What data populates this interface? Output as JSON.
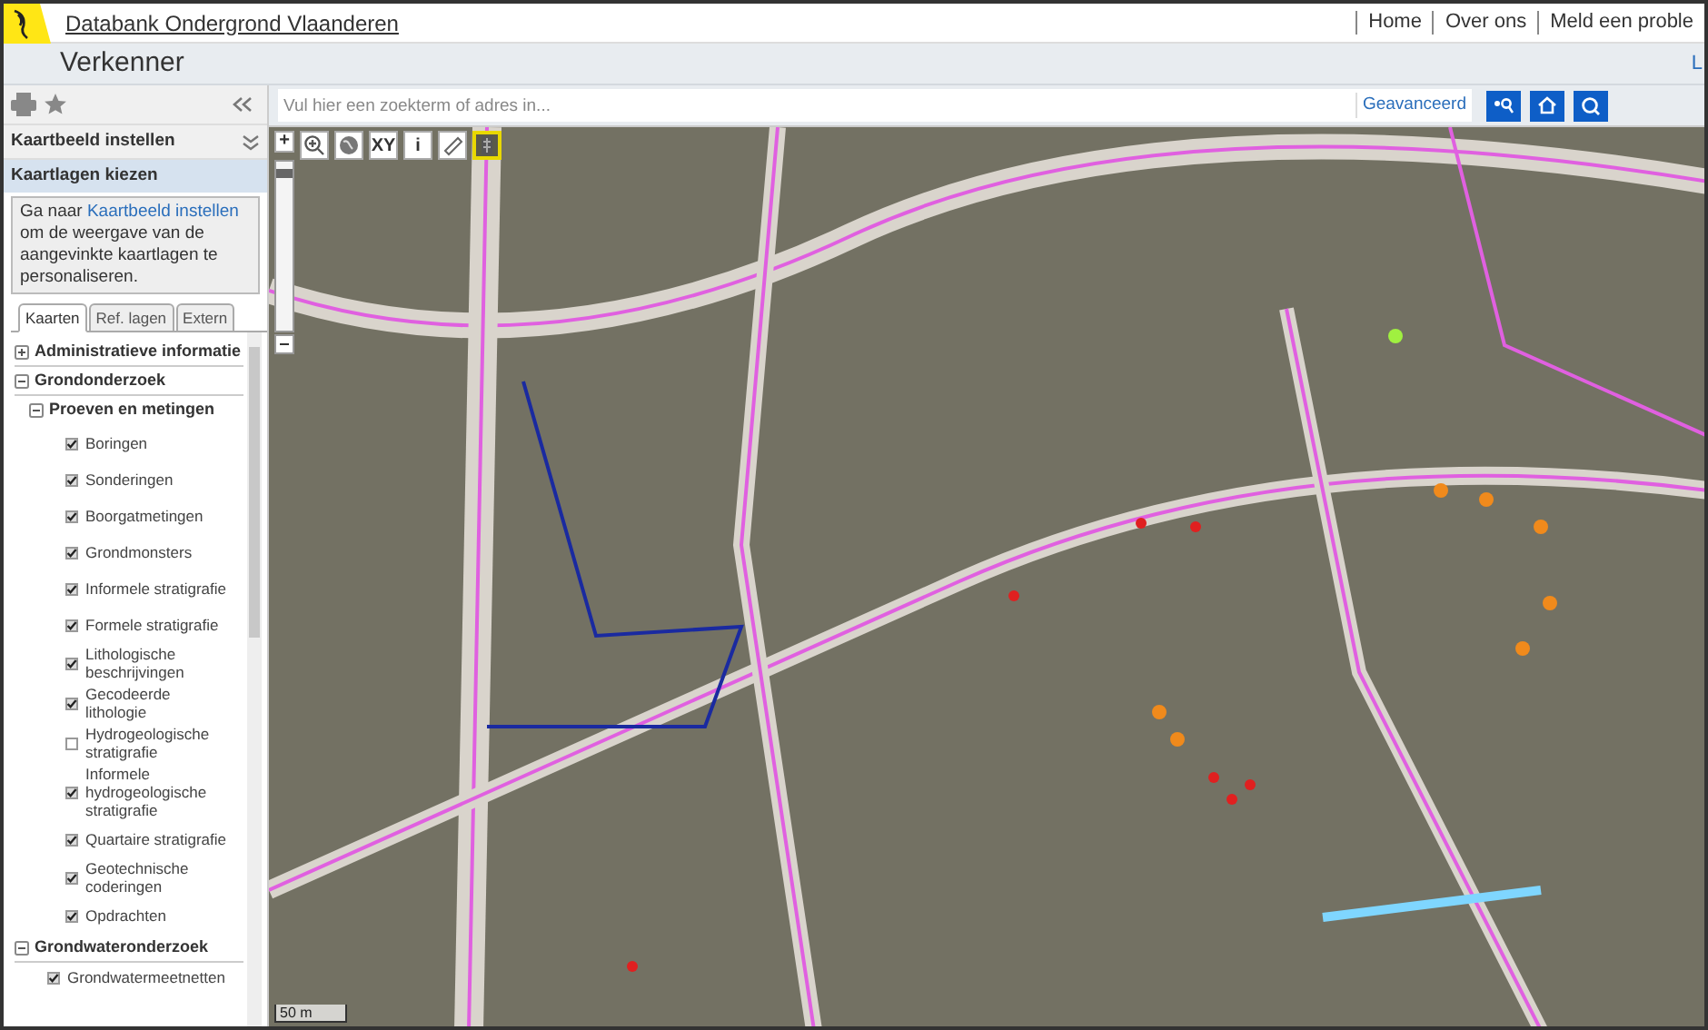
{
  "header": {
    "site_title": "Databank Ondergrond Vlaanderen",
    "links": [
      "Home",
      "Over ons",
      "Meld een proble"
    ]
  },
  "title_bar": {
    "title": "Verkenner",
    "right_text": "L"
  },
  "sidebar": {
    "sections": [
      {
        "label": "Kaartbeeld instellen",
        "selected": false
      },
      {
        "label": "Kaartlagen kiezen",
        "selected": true
      }
    ],
    "info_parts": [
      "Ga naar ",
      "Kaartbeeld instellen",
      " om de weergave van de aangevinkte kaartlagen te personaliseren."
    ],
    "tabs": [
      {
        "label": "Kaarten",
        "selected": true
      },
      {
        "label": "Ref. lagen",
        "selected": false
      },
      {
        "label": "Extern",
        "selected": false
      }
    ],
    "tree": [
      {
        "label": "Administratieve informatie",
        "kind": "group",
        "expanded": false
      },
      {
        "label": "Grondonderzoek",
        "kind": "group",
        "expanded": true,
        "children": [
          {
            "label": "Proeven en metingen",
            "kind": "group",
            "expanded": true,
            "children": [
              {
                "label": "Boringen",
                "kind": "layer",
                "checked": true
              },
              {
                "label": "Sonderingen",
                "kind": "layer",
                "checked": true
              },
              {
                "label": "Boorgatmetingen",
                "kind": "layer",
                "checked": true
              },
              {
                "label": "Grondmonsters",
                "kind": "layer",
                "checked": true
              },
              {
                "label": "Informele stratigrafie",
                "kind": "layer",
                "checked": true
              },
              {
                "label": "Formele stratigrafie",
                "kind": "layer",
                "checked": true
              },
              {
                "label": "Lithologische beschrijvingen",
                "kind": "layer",
                "checked": true
              },
              {
                "label": "Gecodeerde lithologie",
                "kind": "layer",
                "checked": true
              },
              {
                "label": "Hydrogeologische stratigrafie",
                "kind": "layer",
                "checked": false
              },
              {
                "label": "Informele hydrogeologische stratigrafie",
                "kind": "layer",
                "checked": true
              },
              {
                "label": "Quartaire stratigrafie",
                "kind": "layer",
                "checked": true
              },
              {
                "label": "Geotechnische coderingen",
                "kind": "layer",
                "checked": true
              },
              {
                "label": "Opdrachten",
                "kind": "layer",
                "checked": true
              }
            ]
          }
        ]
      },
      {
        "label": "Grondwateronderzoek",
        "kind": "group",
        "expanded": true,
        "children": [
          {
            "label": "Grondwatermeetnetten",
            "kind": "layer",
            "checked": true
          }
        ]
      }
    ]
  },
  "search": {
    "placeholder": "Vul hier een zoekterm of adres in...",
    "advanced_link": "Geavanceerd"
  },
  "map": {
    "tools": [
      {
        "label": "+",
        "kind": "text",
        "selected": false
      },
      {
        "kind": "zoom",
        "selected": false
      },
      {
        "kind": "globe",
        "selected": false
      },
      {
        "label": "XY",
        "kind": "text",
        "selected": false
      },
      {
        "label": "i",
        "kind": "text",
        "selected": false
      },
      {
        "kind": "ruler",
        "selected": false
      },
      {
        "kind": "layers",
        "selected": true
      }
    ],
    "zoom": {
      "level": 0.95
    },
    "scale": "50 m"
  }
}
